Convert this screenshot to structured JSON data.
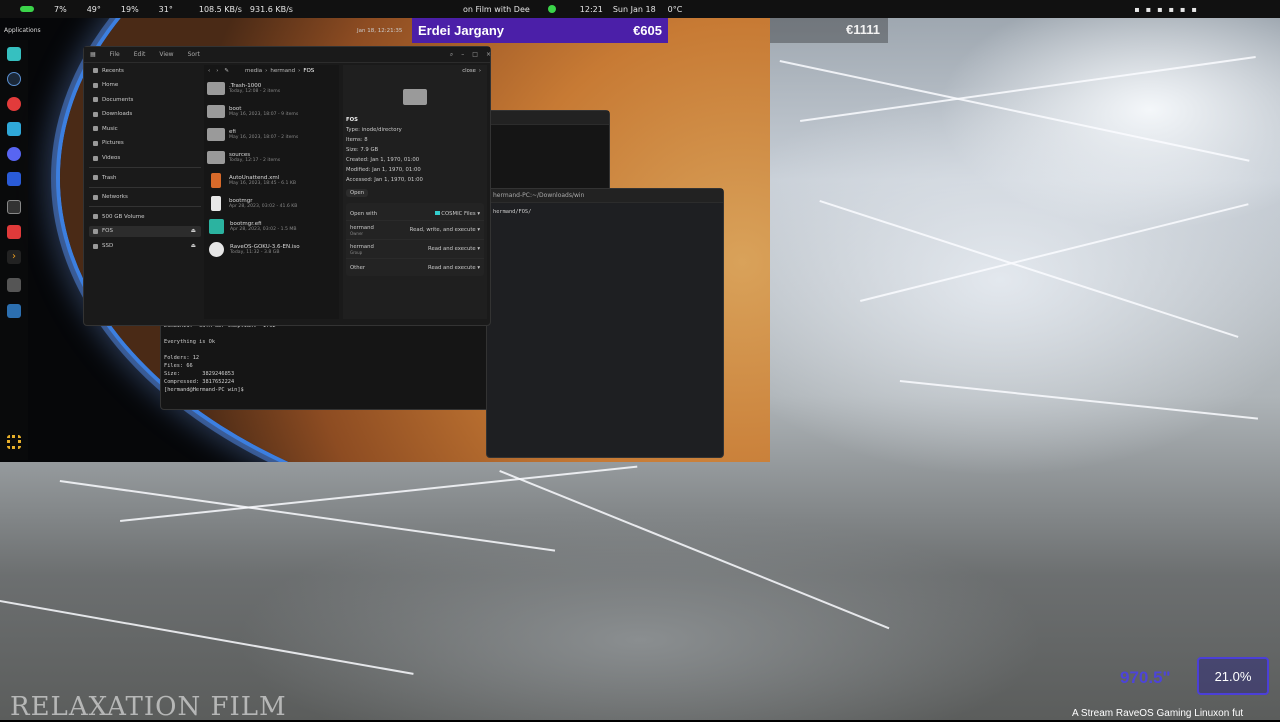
{
  "topbar": {
    "apps_label": "Applications",
    "cpu": "7%",
    "temp1": "49°",
    "mem": "19%",
    "temp2": "31°",
    "down": "108.5 KB/s",
    "up": "931.6 KB/s",
    "now_playing": "on Film with Dee",
    "time": "12:21",
    "date": "Sun Jan 18",
    "weather": "0°C"
  },
  "clock_small": "Jan 18, 12:21:35",
  "banner": {
    "name": "Erdei Jargany",
    "amount": "€605",
    "right_amount": "€1111"
  },
  "file_manager": {
    "menu": [
      "File",
      "Edit",
      "View",
      "Sort"
    ],
    "breadcrumb": [
      "media",
      "hermand",
      "FOS"
    ],
    "sidebar": [
      {
        "label": "Recents"
      },
      {
        "label": "Home"
      },
      {
        "label": "Documents"
      },
      {
        "label": "Downloads"
      },
      {
        "label": "Music"
      },
      {
        "label": "Pictures"
      },
      {
        "label": "Videos"
      },
      {
        "label": "Trash"
      },
      {
        "label": "Networks"
      },
      {
        "label": "500 GB Volume"
      },
      {
        "label": "FOS"
      },
      {
        "label": "SSD"
      }
    ],
    "files": [
      {
        "name": ".Trash-1000",
        "meta": "Today, 12:08 - 2 items"
      },
      {
        "name": "boot",
        "meta": "May 16, 2023, 18:07 - 9 items"
      },
      {
        "name": "efi",
        "meta": "May 16, 2023, 18:07 - 2 items"
      },
      {
        "name": "sources",
        "meta": "Today, 12:17 - 2 items"
      },
      {
        "name": "AutoUnattend.xml",
        "meta": "May 16, 2023, 18:45 - 6.1 KB"
      },
      {
        "name": "bootmgr",
        "meta": "Apr 28, 2023, 03:02 - 41.6 KB"
      },
      {
        "name": "bootmgr.efi",
        "meta": "Apr 28, 2023, 03:02 - 1.5 MB"
      },
      {
        "name": "RaveOS-GOKU-3.6-EN.iso",
        "meta": "Today, 11:32 - 3.8 GB"
      }
    ],
    "props": {
      "close": "close",
      "title": "FOS",
      "type": "Type: inode/directory",
      "items": "Items: 8",
      "size": "Size: 7.9 GB",
      "created": "Created: Jan 1, 1970, 01:00",
      "modified": "Modified: Jan 1, 1970, 01:00",
      "accessed": "Accessed: Jan 1, 1970, 01:00",
      "open_btn": "Open",
      "open_with_label": "Open with",
      "open_with_value": "COSMIC Files",
      "perms": [
        {
          "who": "hermand",
          "role": "Owner",
          "value": "Read, write, and execute"
        },
        {
          "who": "hermand",
          "role": "Group",
          "value": "Read and execute"
        },
        {
          "who": "Other",
          "role": "",
          "value": "Read and execute"
        }
      ]
    }
  },
  "terminal": {
    "lines": [
      "Domainid: \"OSTA UDF Compliant\" 1.02",
      "",
      "Everything is Ok",
      "",
      "Folders: 12",
      "Files: 66",
      "Size:       3829246853",
      "Compressed: 3817652224",
      "[hermand@Hermand-PC win]$ "
    ]
  },
  "terminal2": {
    "title": "hermand-PC:~/Downloads/win",
    "path": "hermand/FOS/"
  },
  "overlay": {
    "watermark": "RELAXATION FILM",
    "duration": "970.5\"",
    "percent": "21.0%",
    "ticker": "A Stream RaveOS Gaming Linuxon fut"
  }
}
